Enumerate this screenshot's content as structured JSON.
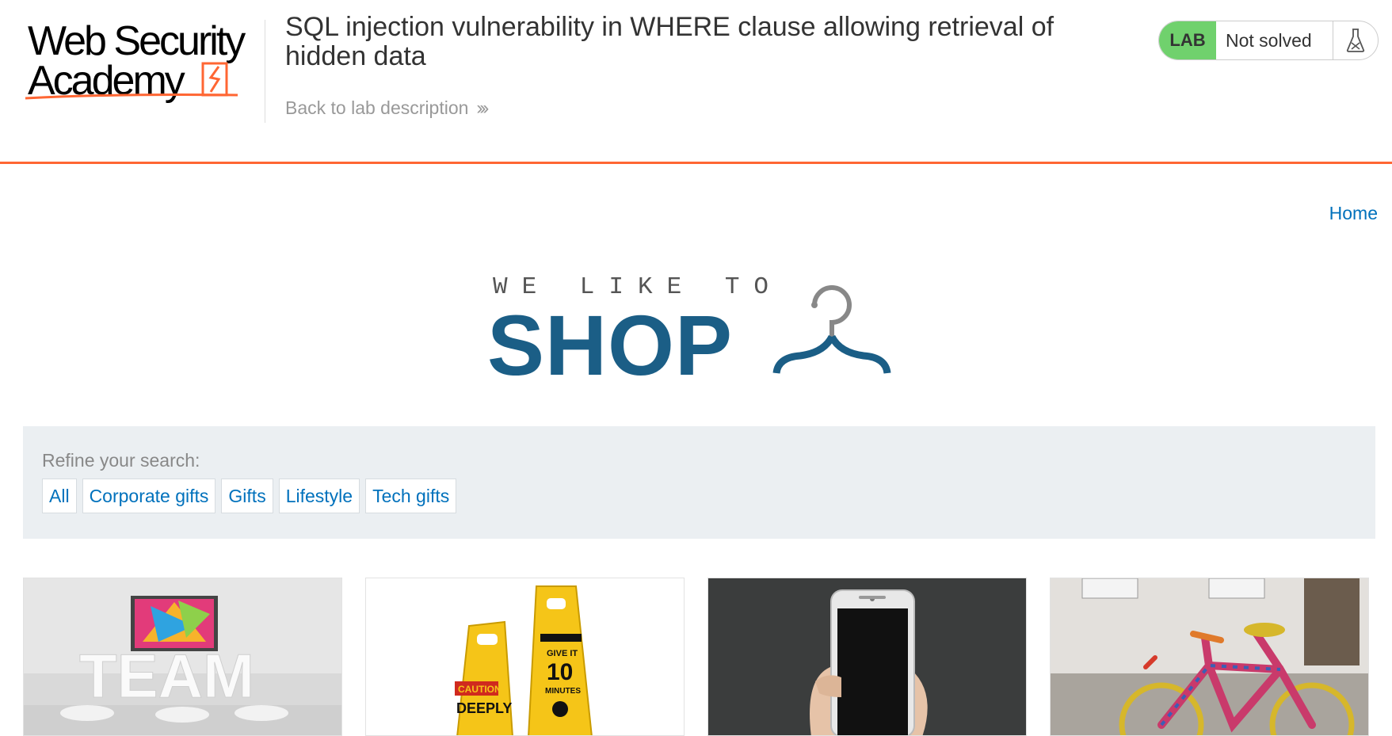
{
  "academy": {
    "logo_line1": "Web Security",
    "logo_line2": "Academy",
    "lab_title": "SQL injection vulnerability in WHERE clause allowing retrieval of hidden data",
    "back_link": "Back to lab description",
    "lab_badge": "LAB",
    "status": "Not solved",
    "accent_color": "#ff6633",
    "badge_color": "#70d16d",
    "icons": {
      "back": "double-chevron-right-icon",
      "flask": "flask-icon"
    }
  },
  "nav": {
    "home": "Home"
  },
  "shop_logo": {
    "tagline": "WE LIKE TO",
    "word": "SHOP",
    "icon": "hanger-icon",
    "color": "#1b5e86"
  },
  "filters": {
    "label": "Refine your search:",
    "categories": [
      "All",
      "Corporate gifts",
      "Gifts",
      "Lifestyle",
      "Tech gifts"
    ]
  },
  "products": [
    {
      "image": "team-building-image"
    },
    {
      "image": "caution-wet-floor-signs-image"
    },
    {
      "image": "hand-holding-phone-image"
    },
    {
      "image": "knitted-bicycle-image"
    }
  ]
}
